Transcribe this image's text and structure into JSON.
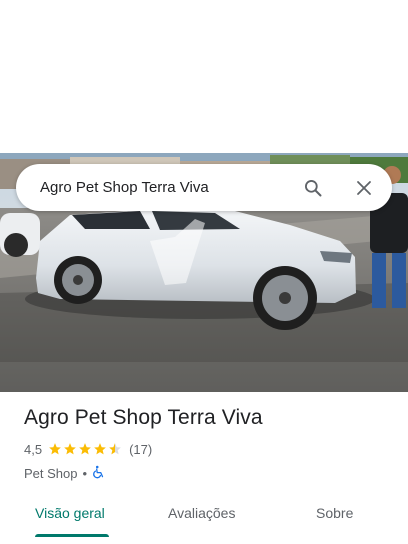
{
  "search": {
    "query": "Agro Pet Shop Terra Viva"
  },
  "place": {
    "name": "Agro Pet Shop Terra Viva",
    "rating": "4,5",
    "rating_value": 4.5,
    "review_count": "(17)",
    "category": "Pet Shop",
    "separator": "•"
  },
  "tabs": [
    {
      "label": "Visão geral",
      "active": true
    },
    {
      "label": "Avaliações",
      "active": false
    },
    {
      "label": "Sobre",
      "active": false
    }
  ],
  "colors": {
    "accent": "#00796b",
    "star": "#fbbc04",
    "wheelchair": "#1a73e8"
  },
  "icons": {
    "search": "search-icon",
    "close": "close-icon",
    "accessibility": "wheelchair-icon"
  }
}
